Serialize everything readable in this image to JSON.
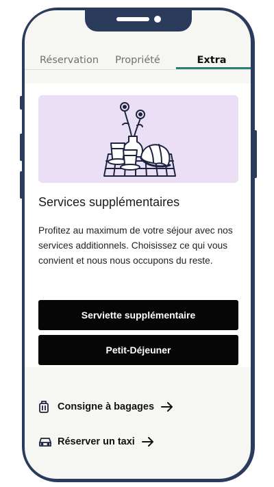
{
  "tabs": [
    {
      "label": "Réservation"
    },
    {
      "label": "Propriété"
    },
    {
      "label": "Extra"
    }
  ],
  "active_tab": "Extra",
  "section": {
    "title": "Services supplémentaires",
    "description": "Profitez au maximum de votre séjour avec nos services additionnels. Choisissez ce qui vous convient et nous nous occupons du reste."
  },
  "buttons": {
    "extra_towel": "Serviette supplémentaire",
    "breakfast": "Petit-Déjeuner"
  },
  "links": [
    {
      "label": "Consigne à bagages",
      "icon": "luggage-icon"
    },
    {
      "label": "Réserver un taxi",
      "icon": "car-icon"
    }
  ],
  "colors": {
    "frame": "#2b3b5c",
    "accent": "#2f7d78",
    "hero_bg": "#ebdff5",
    "button_bg": "#060606"
  }
}
